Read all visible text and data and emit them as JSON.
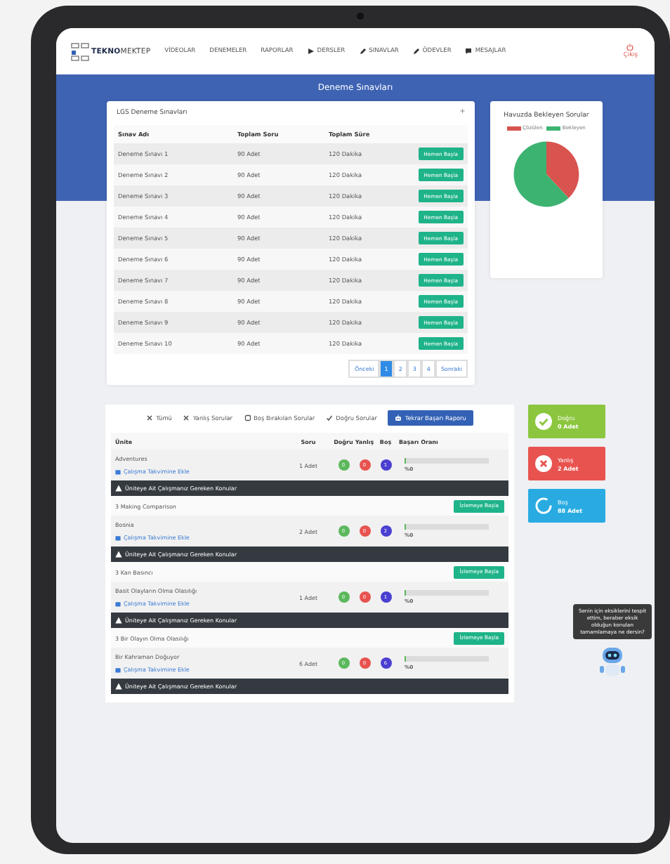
{
  "nav": {
    "logo": {
      "bold": "TEKNO",
      "rest": "MEKTEP"
    },
    "items": [
      {
        "label": "VİDEOLAR"
      },
      {
        "label": "DENEMELER"
      },
      {
        "label": "RAPORLAR"
      },
      {
        "label": "DERSLER"
      },
      {
        "label": "SINAVLAR"
      },
      {
        "label": "ÖDEVLER"
      },
      {
        "label": "MESAJLAR"
      }
    ],
    "logout": "Çıkış"
  },
  "page_title": "Deneme Sınavları",
  "exams": {
    "title": "LGS Deneme Sınavları",
    "add": "+",
    "columns": [
      "Sınav Adı",
      "Toplam Soru",
      "Toplam Süre"
    ],
    "rows": [
      {
        "name": "Deneme Sınavı 1",
        "questions": "90 Adet",
        "duration": "120 Dakika",
        "button": "Hemen Başla"
      },
      {
        "name": "Deneme Sınavı 2",
        "questions": "90 Adet",
        "duration": "120 Dakika",
        "button": "Hemen Başla"
      },
      {
        "name": "Deneme Sınavı 3",
        "questions": "90 Adet",
        "duration": "120 Dakika",
        "button": "Hemen Başla"
      },
      {
        "name": "Deneme Sınavı 4",
        "questions": "90 Adet",
        "duration": "120 Dakika",
        "button": "Hemen Başla"
      },
      {
        "name": "Deneme Sınavı 5",
        "questions": "90 Adet",
        "duration": "120 Dakika",
        "button": "Hemen Başla"
      },
      {
        "name": "Deneme Sınavı 6",
        "questions": "90 Adet",
        "duration": "120 Dakika",
        "button": "Hemen Başla"
      },
      {
        "name": "Deneme Sınavı 7",
        "questions": "90 Adet",
        "duration": "120 Dakika",
        "button": "Hemen Başla"
      },
      {
        "name": "Deneme Sınavı 8",
        "questions": "90 Adet",
        "duration": "120 Dakika",
        "button": "Hemen Başla"
      },
      {
        "name": "Deneme Sınavı 9",
        "questions": "90 Adet",
        "duration": "120 Dakika",
        "button": "Hemen Başla"
      },
      {
        "name": "Deneme Sınavı 10",
        "questions": "90 Adet",
        "duration": "120 Dakika",
        "button": "Hemen Başla"
      }
    ],
    "pagination": [
      {
        "label": "Önceki",
        "selected": false
      },
      {
        "label": "1",
        "selected": true
      },
      {
        "label": "2",
        "selected": false
      },
      {
        "label": "3",
        "selected": false
      },
      {
        "label": "4",
        "selected": false
      },
      {
        "label": "Sonraki",
        "selected": false
      }
    ]
  },
  "pool": {
    "title": "Havuzda Bekleyen Sorular",
    "legend": [
      {
        "label": "Çözülen",
        "color": "#d9534f"
      },
      {
        "label": "Bekleyen",
        "color": "#3cb371"
      }
    ]
  },
  "filters": [
    {
      "label": "Tümü",
      "kind": "link"
    },
    {
      "label": "Yanlış Sorular",
      "kind": "link"
    },
    {
      "label": "Boş Bırakılan Sorular",
      "kind": "link"
    },
    {
      "label": "Doğru Sorular",
      "kind": "link"
    },
    {
      "label": "Tekrar Başarı Raporu",
      "kind": "primary"
    }
  ],
  "results": {
    "columns": [
      "Ünite",
      "Soru",
      "Doğru",
      "Yanlış",
      "Boş",
      "Başarı Oranı"
    ],
    "rows": [
      {
        "kind": "topic",
        "name": "Adventures",
        "link": "Çalışma Takvimine Ekle",
        "count": "1 Adet",
        "correct": "0",
        "wrong": "0",
        "empty": "1",
        "level": 0,
        "rate": "%0"
      },
      {
        "kind": "warning",
        "text": "Üniteye Ait Çalışmanız Gereken Konular"
      },
      {
        "kind": "video",
        "name": "3 Making Comparison",
        "button": "İzlemeye Başla"
      },
      {
        "kind": "topic",
        "name": "Bosnia",
        "link": "Çalışma Takvimine Ekle",
        "count": "2 Adet",
        "correct": "0",
        "wrong": "0",
        "empty": "2",
        "level": 0,
        "rate": "%0"
      },
      {
        "kind": "warning",
        "text": "Üniteye Ait Çalışmanız Gereken Konular"
      },
      {
        "kind": "video",
        "name": "3 Kan Basıncı",
        "button": "İzlemeye Başla"
      },
      {
        "kind": "topic",
        "name": "Basit Olayların Olma Olasılığı",
        "link": "Çalışma Takvimine Ekle",
        "count": "1 Adet",
        "correct": "0",
        "wrong": "0",
        "empty": "1",
        "level": 0,
        "rate": "%0"
      },
      {
        "kind": "warning",
        "text": "Üniteye Ait Çalışmanız Gereken Konular"
      },
      {
        "kind": "video",
        "name": "3 Bir Olayın Olma Olasılığı",
        "button": "İzlemeye Başla"
      },
      {
        "kind": "topic",
        "name": "Bir Kahraman Doğuyor",
        "link": "Çalışma Takvimine Ekle",
        "count": "6 Adet",
        "correct": "0",
        "wrong": "0",
        "empty": "6",
        "level": 0,
        "rate": "%0"
      },
      {
        "kind": "warning",
        "text": "Üniteye Ait Çalışmanız Gereken Konular"
      }
    ]
  },
  "summary": [
    {
      "kind": "correct",
      "label": "Doğru",
      "value": "0 Adet"
    },
    {
      "kind": "wrong",
      "label": "Yanlış",
      "value": "2 Adet"
    },
    {
      "kind": "empty",
      "label": "Boş",
      "value": "88 Adet"
    }
  ],
  "assistant": {
    "message": "Senin için eksiklerini tespit ettim, beraber eksik olduğun konuları tamamlamaya ne dersin?"
  }
}
